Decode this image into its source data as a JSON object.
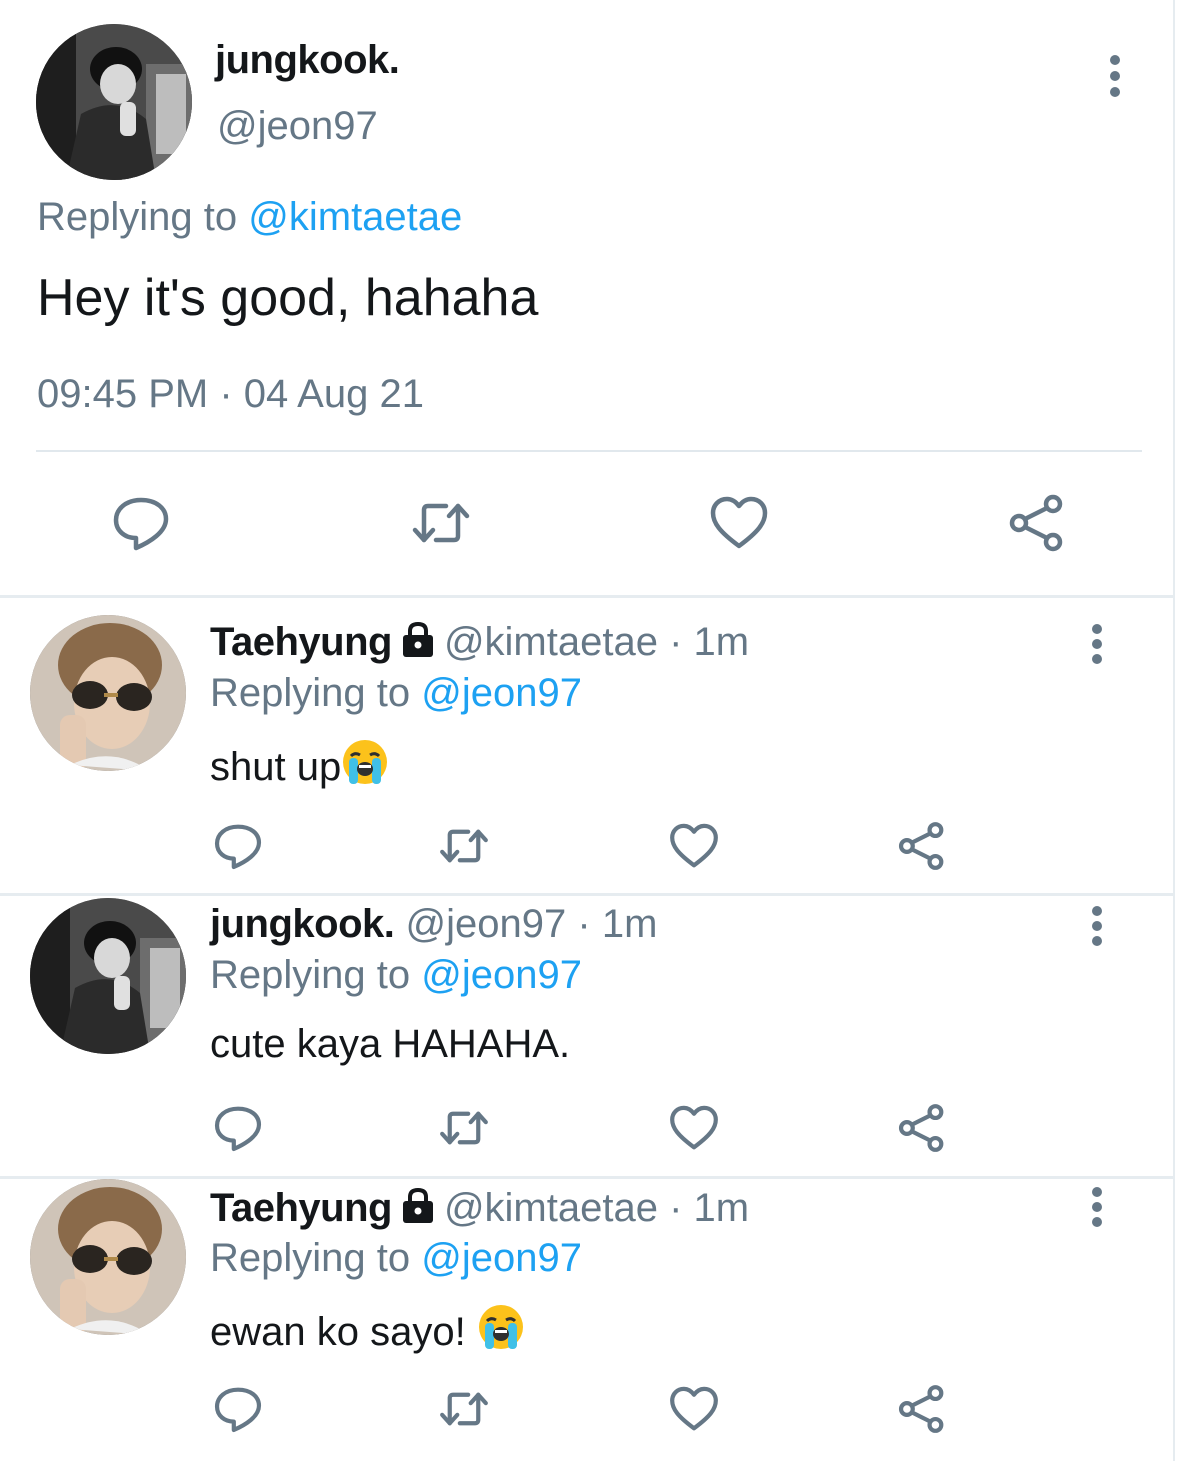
{
  "main_tweet": {
    "display_name": "jungkook.",
    "handle": "@jeon97",
    "replying_prefix": "Replying to",
    "replying_to": "@kimtaetae",
    "text": "Hey it's good, hahaha",
    "timestamp": "09:45 PM · 04 Aug 21",
    "actions": [
      "reply-icon",
      "retweet-icon",
      "like-icon",
      "share-icon"
    ]
  },
  "replies": [
    {
      "display_name": "Taehyung",
      "locked": true,
      "handle": "@kimtaetae",
      "sep": "·",
      "time": "1m",
      "replying_prefix": "Replying to",
      "replying_to": "@jeon97",
      "text": "shut up",
      "emoji": "loudly-crying-face"
    },
    {
      "display_name": "jungkook.",
      "locked": false,
      "handle": "@jeon97",
      "sep": "·",
      "time": "1m",
      "replying_prefix": "Replying to",
      "replying_to": "@jeon97",
      "text": "cute kaya HAHAHA."
    },
    {
      "display_name": "Taehyung",
      "locked": true,
      "handle": "@kimtaetae",
      "sep": "·",
      "time": "1m",
      "replying_prefix": "Replying to",
      "replying_to": "@jeon97",
      "text": "ewan ko sayo! ",
      "emoji": "loudly-crying-face"
    }
  ],
  "colors": {
    "text": "#14171a",
    "secondary": "#657786",
    "accent": "#1da1f2",
    "divider": "#e6ecf0",
    "icon": "#657786"
  }
}
